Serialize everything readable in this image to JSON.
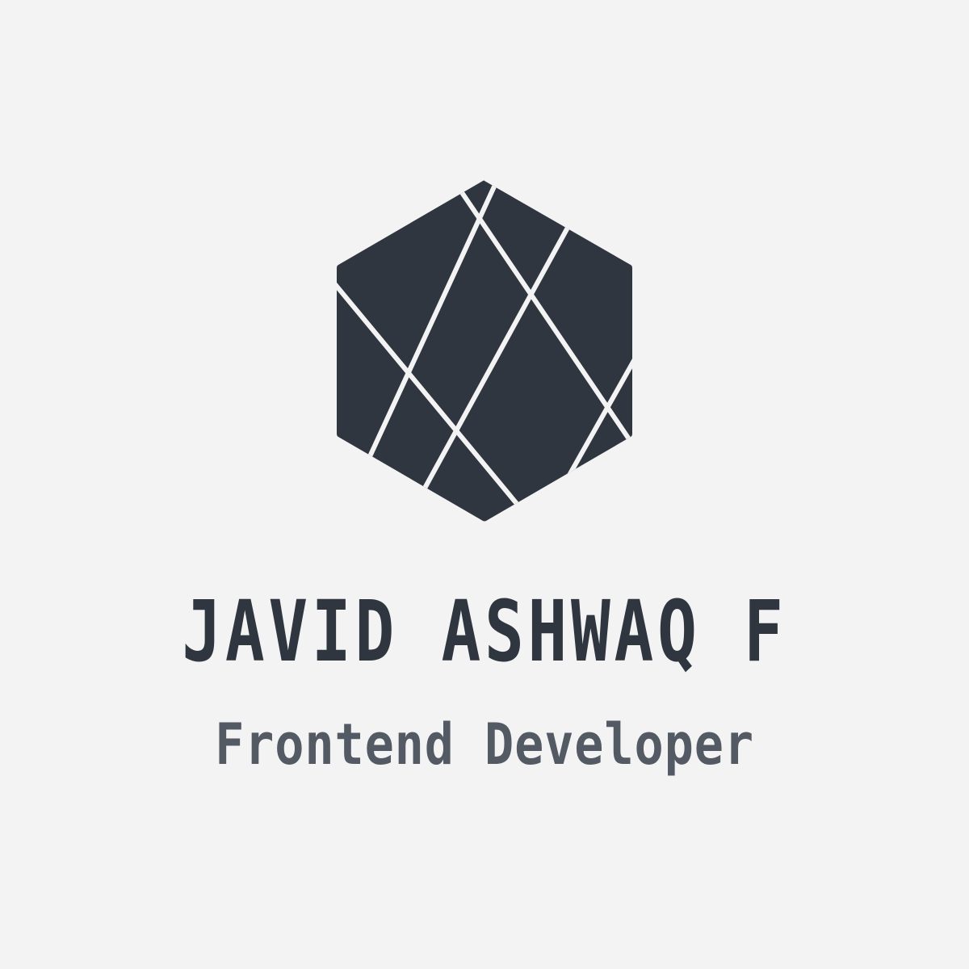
{
  "colors": {
    "background": "#f3f3f3",
    "mark": "#303640",
    "name": "#303640",
    "role": "#535a64"
  },
  "logo": {
    "icon": "faceted-hexagon-icon"
  },
  "identity": {
    "name": "JAVID ASHWAQ F",
    "role": "Frontend Developer"
  }
}
